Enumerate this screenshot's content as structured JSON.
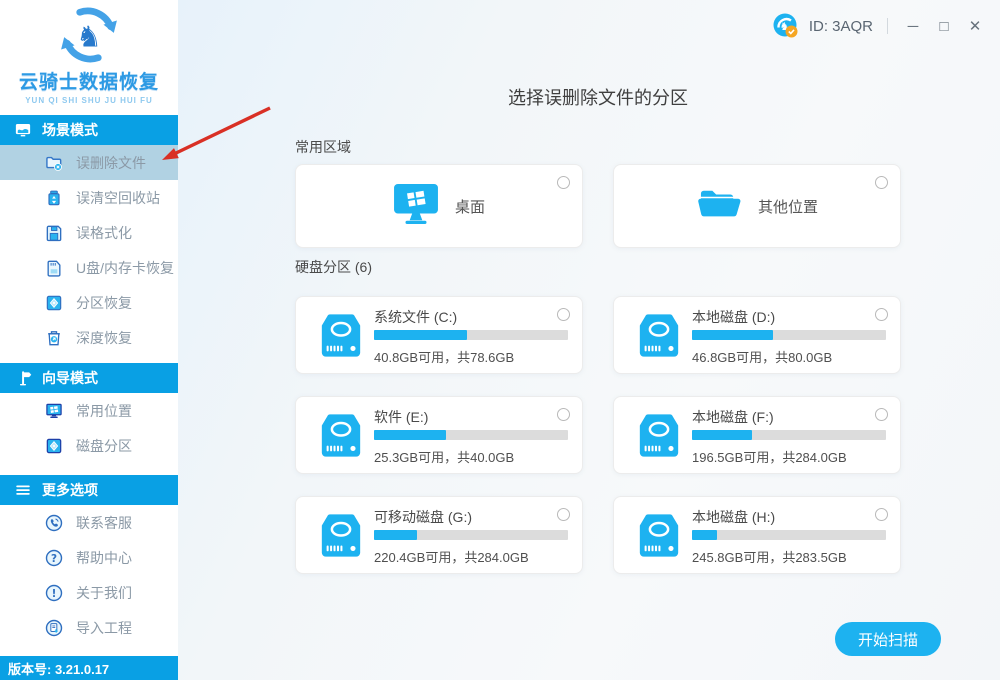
{
  "window": {
    "id_label": "ID: 3AQR",
    "minimize": "─",
    "maximize": "□",
    "close": "✕"
  },
  "branding": {
    "app_name": "云骑士数据恢复",
    "tagline": "YUN QI SHI SHU JU HUI FU",
    "version_label": "版本号: 3.21.0.17",
    "logo_icon": "knight-circular-arrows-logo",
    "id_badge_icon": "id-badge-icon"
  },
  "colors": {
    "primary_blue": "#09a0e4",
    "accent_cyan": "#1db2f0",
    "selected_item_bg": "#b1d2e3",
    "bar_track": "#dcdcdc",
    "arrow_red": "#d93025"
  },
  "sidebar": {
    "sections": [
      {
        "key": "scene-mode",
        "label": "场景模式",
        "icon": "scene-mode-icon",
        "items": [
          {
            "key": "deleted-files",
            "label": "误删除文件",
            "icon": "deleted-files-icon",
            "selected": true
          },
          {
            "key": "emptied-recycle-bin",
            "label": "误清空回收站",
            "icon": "recycle-bin-icon",
            "selected": false
          },
          {
            "key": "formatted",
            "label": "误格式化",
            "icon": "formatted-icon",
            "selected": false
          },
          {
            "key": "usb-memory-card",
            "label": "U盘/内存卡恢复",
            "icon": "usb-card-icon",
            "selected": false
          },
          {
            "key": "partition-recovery",
            "label": "分区恢复",
            "icon": "partition-icon",
            "selected": false
          },
          {
            "key": "deep-recovery",
            "label": "深度恢复",
            "icon": "deep-recovery-icon",
            "selected": false
          }
        ]
      },
      {
        "key": "wizard-mode",
        "label": "向导模式",
        "icon": "wizard-mode-icon",
        "items": [
          {
            "key": "common-locations",
            "label": "常用位置",
            "icon": "common-location-icon",
            "selected": false
          },
          {
            "key": "disk-partitions",
            "label": "磁盘分区",
            "icon": "disk-partition-icon",
            "selected": false
          }
        ]
      },
      {
        "key": "more-options",
        "label": "更多选项",
        "icon": "more-options-icon",
        "items": [
          {
            "key": "contact-support",
            "label": "联系客服",
            "icon": "contact-support-icon",
            "selected": false
          },
          {
            "key": "help-center",
            "label": "帮助中心",
            "icon": "help-center-icon",
            "selected": false
          },
          {
            "key": "about-us",
            "label": "关于我们",
            "icon": "about-us-icon",
            "selected": false
          },
          {
            "key": "import-project",
            "label": "导入工程",
            "icon": "import-project-icon",
            "selected": false
          }
        ]
      }
    ]
  },
  "main": {
    "title": "选择误删除文件的分区",
    "common_section_label": "常用区域",
    "common_items": [
      {
        "key": "desktop",
        "label": "桌面",
        "icon": "desktop-icon"
      },
      {
        "key": "other-location",
        "label": "其他位置",
        "icon": "other-location-icon"
      }
    ],
    "partition_section_label": "硬盘分区 (6)",
    "partition_icon": "disk-drive-icon",
    "partitions": [
      {
        "key": "c",
        "name": "系统文件 (C:)",
        "capacity": "40.8GB可用，共78.6GB",
        "used_pct": 48
      },
      {
        "key": "d",
        "name": "本地磁盘 (D:)",
        "capacity": "46.8GB可用，共80.0GB",
        "used_pct": 42
      },
      {
        "key": "e",
        "name": "软件 (E:)",
        "capacity": "25.3GB可用，共40.0GB",
        "used_pct": 37
      },
      {
        "key": "f",
        "name": "本地磁盘 (F:)",
        "capacity": "196.5GB可用，共284.0GB",
        "used_pct": 31
      },
      {
        "key": "g",
        "name": "可移动磁盘 (G:)",
        "capacity": "220.4GB可用，共284.0GB",
        "used_pct": 22
      },
      {
        "key": "h",
        "name": "本地磁盘 (H:)",
        "capacity": "245.8GB可用，共283.5GB",
        "used_pct": 13
      }
    ],
    "scan_button_label": "开始扫描"
  }
}
